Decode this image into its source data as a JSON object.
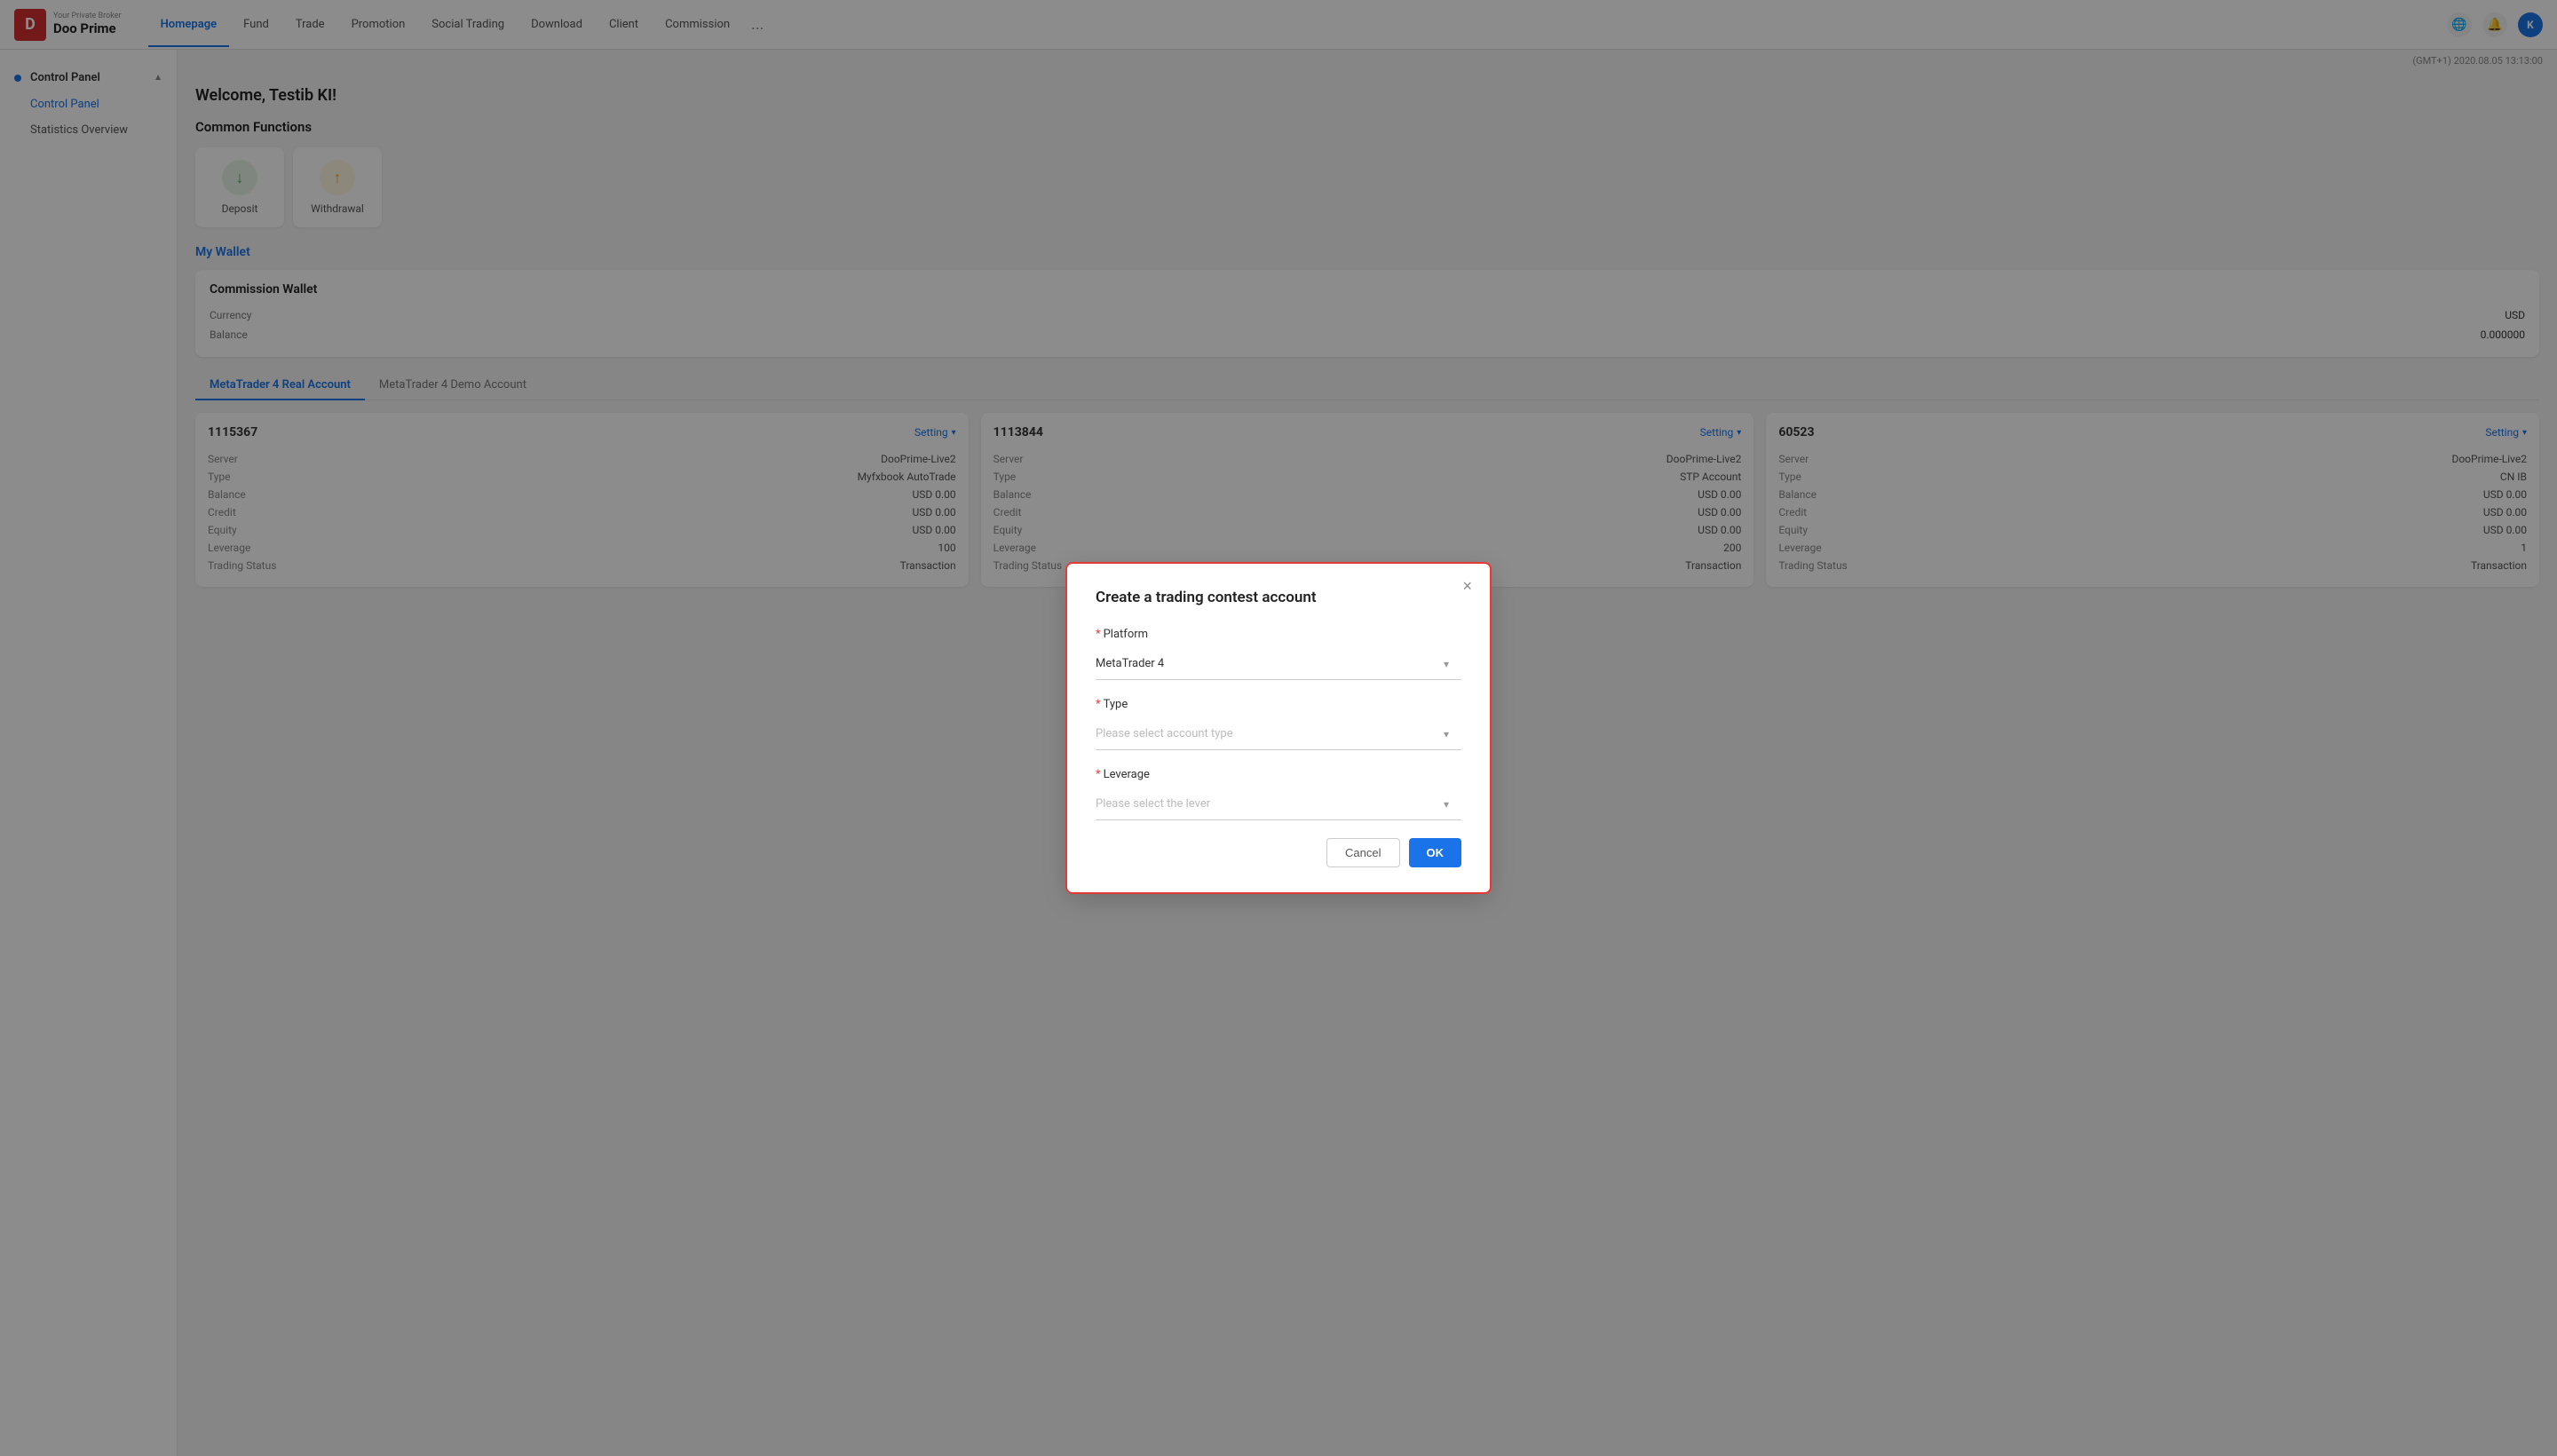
{
  "nav": {
    "logo_sub": "Your Private Broker",
    "logo_main": "Doo Prime",
    "items": [
      {
        "label": "Homepage",
        "active": true
      },
      {
        "label": "Fund"
      },
      {
        "label": "Trade"
      },
      {
        "label": "Promotion"
      },
      {
        "label": "Social Trading"
      },
      {
        "label": "Download"
      },
      {
        "label": "Client"
      },
      {
        "label": "Commission"
      },
      {
        "label": "..."
      }
    ],
    "avatar_letter": "K"
  },
  "timestamp": "(GMT+1) 2020.08.05 13:13:00",
  "sidebar": {
    "section_label": "Control Panel",
    "items": [
      {
        "label": "Control Panel",
        "active": true
      },
      {
        "label": "Statistics Overview"
      }
    ]
  },
  "main": {
    "welcome": "Welcome, Testib KI!",
    "common_functions_title": "Common Functions",
    "deposit_label": "Deposit",
    "withdrawal_label": "Withdrawal",
    "my_wallet_label": "My Wallet",
    "commission_wallet": {
      "title": "Commission Wallet",
      "rows": [
        {
          "label": "Currency",
          "value": "USD"
        },
        {
          "label": "Balance",
          "value": "0.000000"
        }
      ]
    },
    "tabs": [
      {
        "label": "MetaTrader 4 Real Account",
        "active": true
      },
      {
        "label": "MetaTrader 4 Demo Account"
      }
    ],
    "accounts": [
      {
        "number": "1115367",
        "setting_label": "Setting",
        "rows": [
          {
            "label": "Server",
            "value": "DooPrime-Live2"
          },
          {
            "label": "Type",
            "value": "Myfxbook AutoTrade"
          },
          {
            "label": "Balance",
            "value": "USD 0.00"
          },
          {
            "label": "Credit",
            "value": "USD 0.00"
          },
          {
            "label": "Equity",
            "value": "USD 0.00"
          },
          {
            "label": "Leverage",
            "value": "100"
          },
          {
            "label": "Trading Status",
            "value": "Transaction"
          }
        ]
      },
      {
        "number": "1113844",
        "setting_label": "Setting",
        "rows": [
          {
            "label": "Server",
            "value": "DooPrime-Live2"
          },
          {
            "label": "Type",
            "value": "STP Account"
          },
          {
            "label": "Balance",
            "value": "USD 0.00"
          },
          {
            "label": "Credit",
            "value": "USD 0.00"
          },
          {
            "label": "Equity",
            "value": "USD 0.00"
          },
          {
            "label": "Leverage",
            "value": "200"
          },
          {
            "label": "Trading Status",
            "value": "Transaction"
          }
        ]
      },
      {
        "number": "60523",
        "setting_label": "Setting",
        "rows": [
          {
            "label": "Server",
            "value": "DooPrime-Live2"
          },
          {
            "label": "Type",
            "value": "CN IB"
          },
          {
            "label": "Balance",
            "value": "USD 0.00"
          },
          {
            "label": "Credit",
            "value": "USD 0.00"
          },
          {
            "label": "Equity",
            "value": "USD 0.00"
          },
          {
            "label": "Leverage",
            "value": "1"
          },
          {
            "label": "Trading Status",
            "value": "Transaction"
          }
        ]
      }
    ]
  },
  "modal": {
    "title": "Create a trading contest account",
    "close_label": "×",
    "platform_label": "Platform",
    "platform_value": "MetaTrader 4",
    "type_label": "Type",
    "type_placeholder": "Please select account type",
    "leverage_label": "Leverage",
    "leverage_placeholder": "Please select the lever",
    "cancel_label": "Cancel",
    "ok_label": "OK"
  }
}
